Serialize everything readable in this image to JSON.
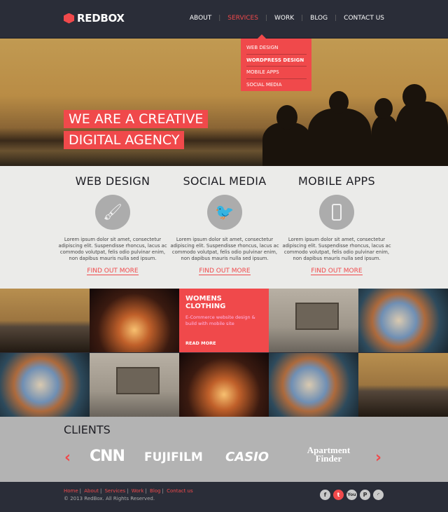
{
  "header": {
    "logo": "REDBOX",
    "nav": [
      {
        "label": "ABOUT"
      },
      {
        "label": "SERVICES",
        "active": true
      },
      {
        "label": "WORK"
      },
      {
        "label": "BLOG"
      },
      {
        "label": "CONTACT US"
      }
    ],
    "dropdown": [
      "WEB DESIGN",
      "WORDPRESS DESIGN",
      "MOBILE APPS",
      "SOCIAL MEDIA"
    ]
  },
  "hero": {
    "line1": "WE ARE A CREATIVE",
    "line2": "DIGITAL AGENCY"
  },
  "services": [
    {
      "title": "WEB DESIGN",
      "icon": "paintbrush-icon",
      "text": "Lorem ipsum dolor sit amet, consectetur adipiscing elit. Suspendisse rhoncus, lacus ac commodo volutpat, felis odio pulvinar enim, non dapibus mauris nulla sed ipsum.",
      "link": "FIND OUT MORE"
    },
    {
      "title": "SOCIAL MEDIA",
      "icon": "twitter-icon",
      "text": "Lorem ipsum dolor sit amet, consectetur adipiscing elit. Suspendisse rhoncus, lacus ac commodo volutpat, felis odio pulvinar enim, non dapibus mauris nulla sed ipsum.",
      "link": "FIND OUT MORE"
    },
    {
      "title": "MOBILE APPS",
      "icon": "smartphone-icon",
      "text": "Lorem ipsum dolor sit amet, consectetur adipiscing elit. Suspendisse rhoncus, lacus ac commodo volutpat, felis odio pulvinar enim, non dapibus mauris nulla sed ipsum.",
      "link": "FIND OUT MORE"
    }
  ],
  "promo": {
    "title": "WOMENS CLOTHING",
    "text": "E-Commerce website design & build with mobile site",
    "link": "READ MORE"
  },
  "clients": {
    "title": "CLIENTS",
    "logos": [
      "CNN",
      "FUJIFILM",
      "CASIO",
      "Apartment Finder"
    ]
  },
  "footer": {
    "links": [
      "Home",
      "About",
      "Services",
      "Work",
      "Blog",
      "Contact us"
    ],
    "copyright": "© 2013 RedBox. All Rights Reserved.",
    "social": [
      "facebook",
      "twitter",
      "youtube",
      "pinterest",
      "rss"
    ]
  },
  "colors": {
    "accent": "#f0494b",
    "dark": "#2a2d38",
    "light": "#ebebe9",
    "clients_bg": "#b3b3b3"
  }
}
